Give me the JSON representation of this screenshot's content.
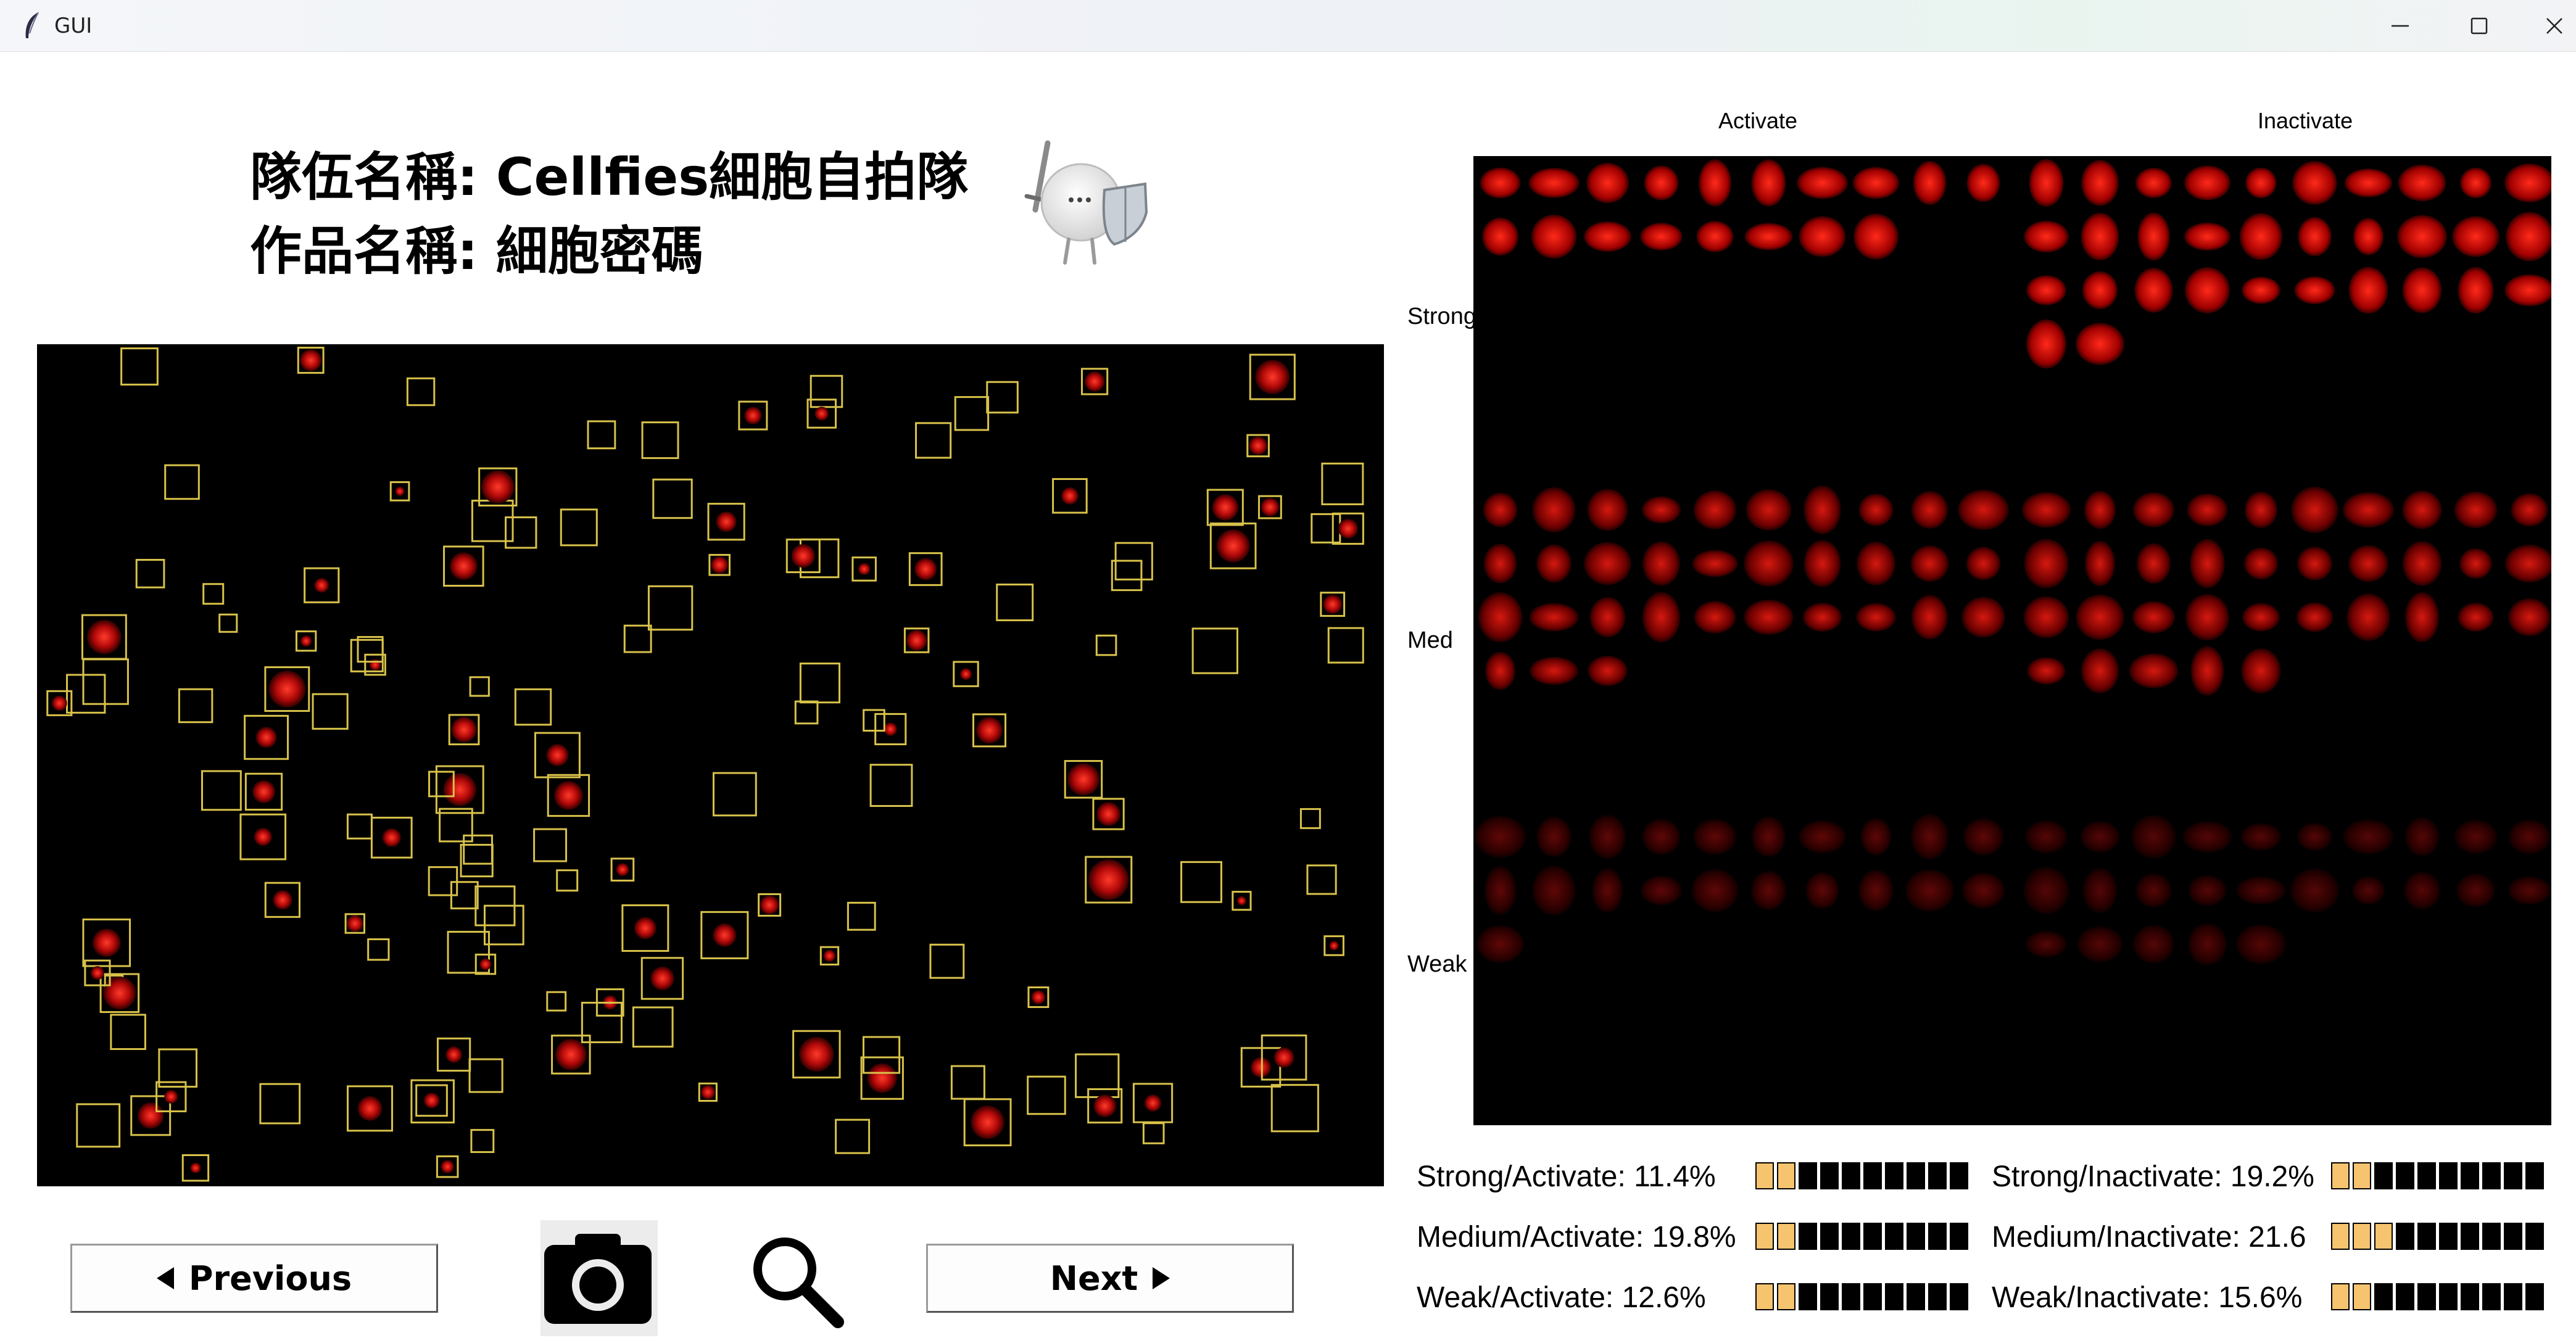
{
  "window": {
    "title": "GUI",
    "controls": {
      "minimize": "minimize-icon",
      "maximize": "maximize-icon",
      "close": "close-icon"
    }
  },
  "header": {
    "team_line": "隊伍名稱: Cellfies細胞自拍隊",
    "work_line": "作品名稱: 細胞密碼",
    "mascot": "knight-cell-mascot"
  },
  "grid": {
    "column_labels": [
      "Activate",
      "Inactivate"
    ],
    "row_labels": [
      "Strong",
      "Med",
      "Weak"
    ]
  },
  "controls": {
    "previous_label": "Previous",
    "next_label": "Next",
    "camera_icon": "camera-icon",
    "search_icon": "search-icon"
  },
  "stats": [
    {
      "label": "Strong/Activate: 11.4%",
      "fraction": 0.2
    },
    {
      "label": "Strong/Inactivate: 19.2%",
      "fraction": 0.2
    },
    {
      "label": "Medium/Activate: 19.8%",
      "fraction": 0.2
    },
    {
      "label": "Medium/Inactivate: 21.6",
      "fraction": 0.3
    },
    {
      "label": "Weak/Activate: 12.6%",
      "fraction": 0.2
    },
    {
      "label": "Weak/Inactivate: 15.6%",
      "fraction": 0.2
    }
  ],
  "colors": {
    "box_outline": "#d8c24a",
    "cell": "#d01010",
    "bar_fill": "#f6c46e",
    "bar_empty": "#000000"
  }
}
